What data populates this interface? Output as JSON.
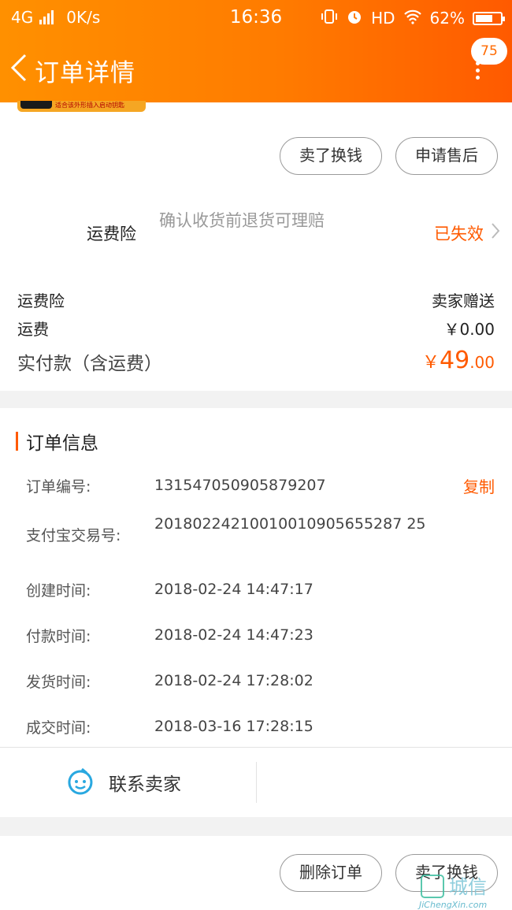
{
  "status_bar": {
    "network": "4G",
    "speed": "0K/s",
    "time": "16:36",
    "hd": "HD",
    "battery_percent": "62%",
    "battery_level": 0.62
  },
  "nav": {
    "title": "订单详情",
    "badge": "75"
  },
  "product_thumb": {
    "text": "适合该外形插入启动钥匙"
  },
  "top_actions": {
    "sell_label": "卖了换钱",
    "after_sale_label": "申请售后"
  },
  "insurance": {
    "label": "运费险",
    "desc": "确认收货前退货可理赔",
    "status": "已失效"
  },
  "costs": {
    "insurance_label": "运费险",
    "insurance_value": "卖家赠送",
    "shipping_label": "运费",
    "shipping_value": "￥0.00",
    "total_label": "实付款（含运费）",
    "total_currency": "￥",
    "total_int": "49",
    "total_dec": ".00"
  },
  "order_info": {
    "title": "订单信息",
    "copy_label": "复制",
    "rows": [
      {
        "label": "订单编号:",
        "value": "131547050905879207"
      },
      {
        "label": "支付宝交易号:",
        "value": "20180224210010010905655287 25"
      },
      {
        "label": "创建时间:",
        "value": "2018-02-24 14:47:17"
      },
      {
        "label": "付款时间:",
        "value": "2018-02-24 14:47:23"
      },
      {
        "label": "发货时间:",
        "value": "2018-02-24 17:28:02"
      },
      {
        "label": "成交时间:",
        "value": "2018-03-16 17:28:15"
      }
    ]
  },
  "contact": {
    "label": "联系卖家"
  },
  "bottom_actions": {
    "delete_label": "删除订单",
    "sell_label": "卖了换钱"
  },
  "watermark": {
    "text": "城信",
    "url": "JiChengXin.com"
  },
  "colors": {
    "brand_orange": "#ff6a00",
    "accent_text": "#ff5a00",
    "gray_band": "#f2f2f2"
  }
}
